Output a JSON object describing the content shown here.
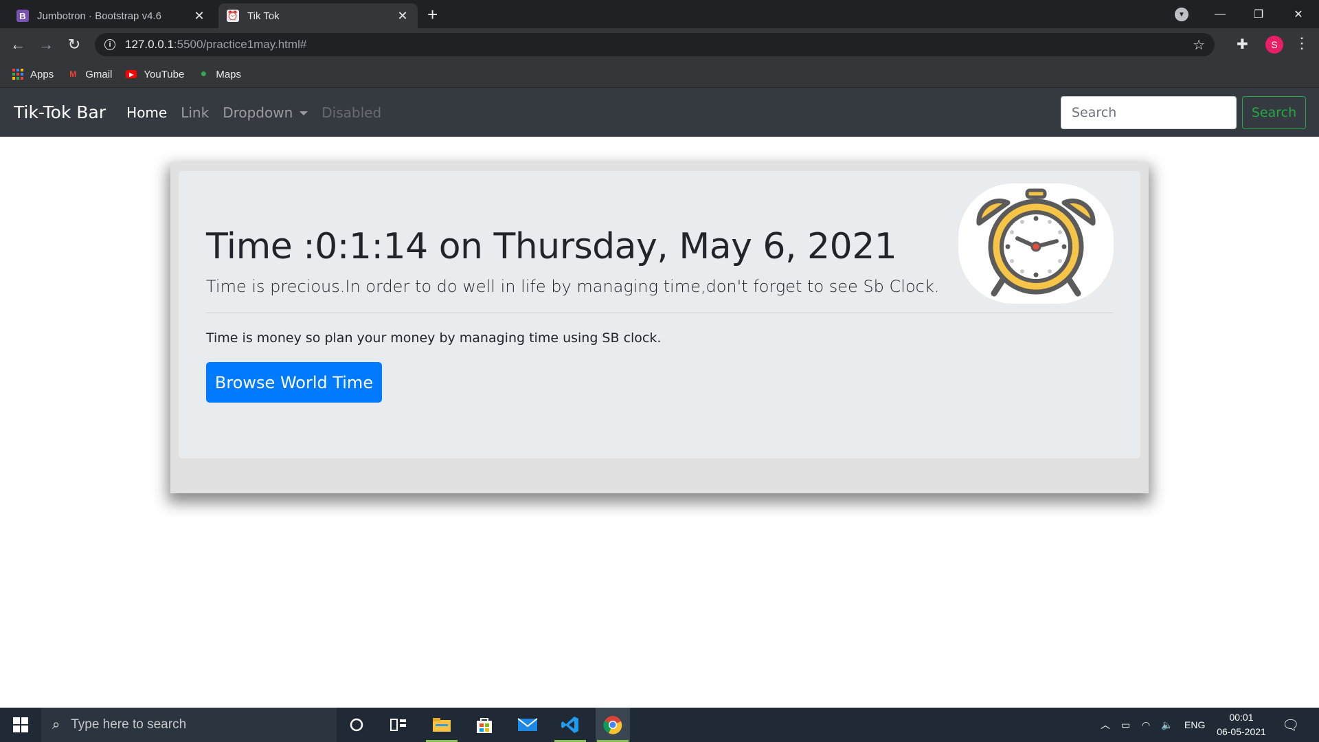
{
  "browser": {
    "tabs": [
      {
        "label": "Jumbotron · Bootstrap v4.6",
        "favicon": "B",
        "active": false
      },
      {
        "label": "Tik Tok",
        "favicon": "clock-favicon",
        "active": true
      }
    ],
    "url_host": "127.0.0.1",
    "url_path": ":5500/practice1may.html#",
    "profile_initial": "S",
    "bookmarks": [
      {
        "label": "Apps",
        "icon": "apps-grid-icon"
      },
      {
        "label": "Gmail",
        "icon": "gmail-icon"
      },
      {
        "label": "YouTube",
        "icon": "youtube-icon"
      },
      {
        "label": "Maps",
        "icon": "maps-icon"
      }
    ]
  },
  "navbar": {
    "brand": "Tik-Tok Bar",
    "links": [
      {
        "label": "Home",
        "state": "active"
      },
      {
        "label": "Link",
        "state": "normal"
      },
      {
        "label": "Dropdown",
        "state": "dropdown"
      },
      {
        "label": "Disabled",
        "state": "disabled"
      }
    ],
    "search_placeholder": "Search",
    "search_button": "Search"
  },
  "jumbotron": {
    "heading": "Time :0:1:14 on Thursday, May 6, 2021",
    "lead": "Time is precious.In order to do well in life by managing time,don't forget to see Sb Clock.",
    "paragraph": "Time is money so plan your money by managing time using SB clock.",
    "button": "Browse World Time",
    "image": "alarm-clock-icon"
  },
  "taskbar": {
    "search_placeholder": "Type here to search",
    "apps": [
      "cortana-icon",
      "task-view-icon",
      "file-explorer-icon",
      "store-icon",
      "mail-icon",
      "vscode-icon",
      "chrome-icon"
    ],
    "tray_language": "ENG",
    "time": "00:01",
    "date": "06-05-2021"
  },
  "colors": {
    "navbar_bg": "#343a40",
    "jumbotron_bg": "#e9ecef",
    "primary": "#007bff",
    "success": "#28a745",
    "clock_yellow": "#f6c447",
    "clock_outline": "#5b5b5b"
  }
}
